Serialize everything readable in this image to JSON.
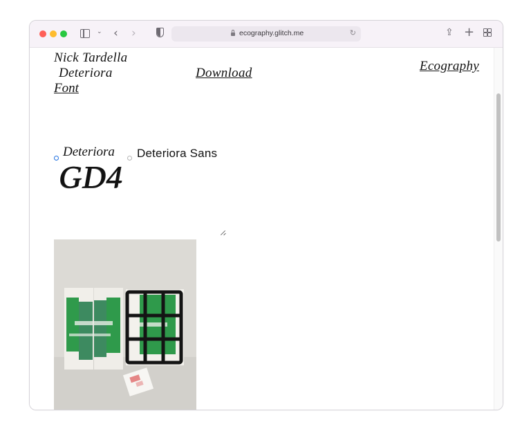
{
  "browser": {
    "url": "ecography.glitch.me"
  },
  "page": {
    "title_line1": "Nick Tardella",
    "title_line2": "Deteriora",
    "title_line3": "Font",
    "download_link": "Download",
    "ecography_link": "Ecography",
    "radio_options": [
      "Deteriora",
      "Deteriora Sans"
    ],
    "selected_option": "Deteriora",
    "specimen_text": "GD4"
  },
  "colors": {
    "radio_accent": "#1f6fe0",
    "photo_green": "#2e9a48",
    "photo_wall": "#dddbd6"
  }
}
